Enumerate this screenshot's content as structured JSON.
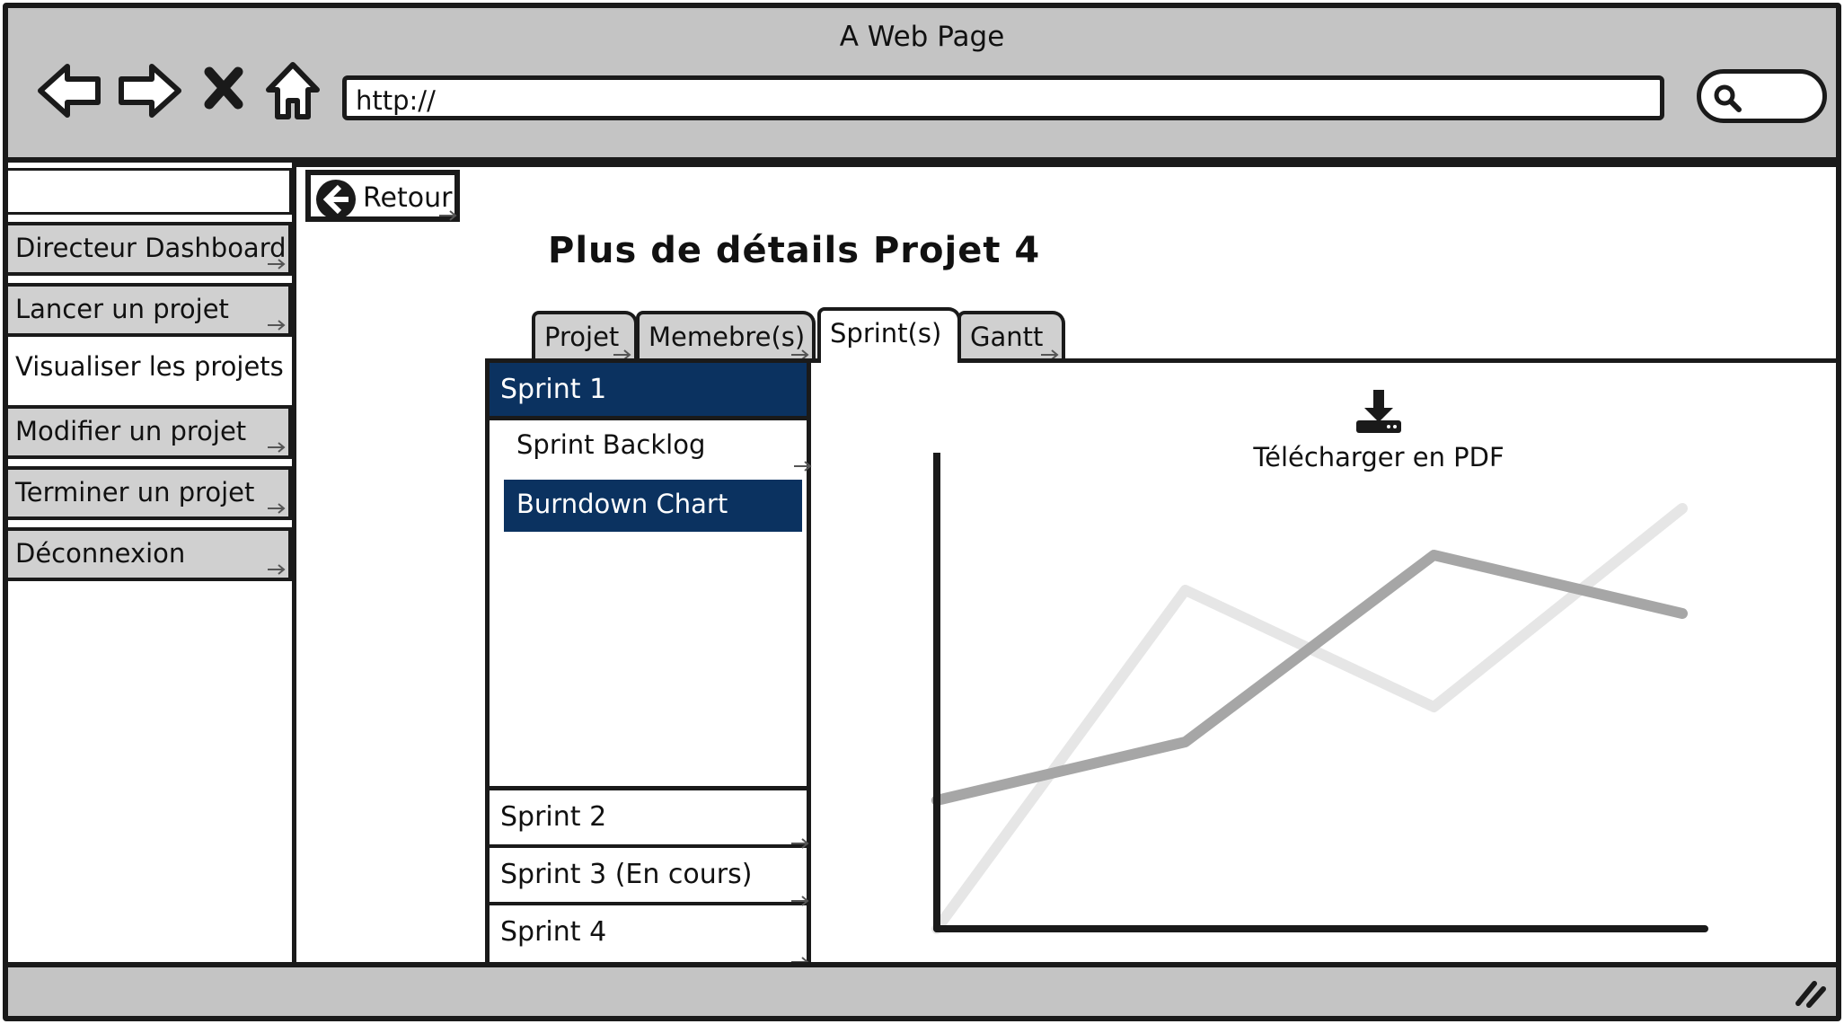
{
  "window": {
    "title": "A Web Page",
    "url": "http://",
    "icons": [
      "back-arrow-icon",
      "forward-arrow-icon",
      "close-icon",
      "home-icon",
      "search-icon",
      "resize-grip-icon"
    ]
  },
  "sidebar": {
    "items": [
      {
        "label": "Directeur Dashboard",
        "active": false
      },
      {
        "label": "Lancer un projet",
        "active": false
      },
      {
        "label": "Visualiser les projets",
        "active": true
      },
      {
        "label": "Modifier un projet",
        "active": false
      },
      {
        "label": "Terminer un projet",
        "active": false
      },
      {
        "label": "Déconnexion",
        "active": false
      }
    ]
  },
  "main": {
    "back_label": "Retour",
    "title": "Plus de détails Projet 4",
    "tabs": [
      {
        "label": "Projet",
        "active": false
      },
      {
        "label": "Memebre(s)",
        "active": false
      },
      {
        "label": "Sprint(s)",
        "active": true
      },
      {
        "label": "Gantt",
        "active": false
      }
    ],
    "sprints": [
      {
        "label": "Sprint 1",
        "selected": true
      },
      {
        "label": "Sprint 2",
        "selected": false
      },
      {
        "label": "Sprint 3 (En cours)",
        "selected": false
      },
      {
        "label": "Sprint 4",
        "selected": false
      }
    ],
    "sprint_items": [
      {
        "label": "Sprint Backlog",
        "selected": false
      },
      {
        "label": "Burndown Chart",
        "selected": true
      }
    ],
    "download_label": "Télécharger en PDF"
  },
  "colors": {
    "selected_bg": "#0b3260",
    "chrome": "#c4c4c4",
    "series_dark": "#a6a6a6",
    "series_light": "#e6e6e6"
  },
  "chart_data": {
    "type": "line",
    "x": [
      0,
      1,
      2,
      3
    ],
    "series": [
      {
        "values": [
          1.1,
          1.6,
          3.2,
          2.7
        ],
        "color": "#a6a6a6"
      },
      {
        "values": [
          0,
          2.9,
          1.9,
          3.6
        ],
        "color": "#e6e6e6"
      }
    ],
    "ylim": [
      0,
      4
    ],
    "xlim": [
      0,
      3
    ],
    "grid": false,
    "title": "",
    "xlabel": "",
    "ylabel": ""
  }
}
